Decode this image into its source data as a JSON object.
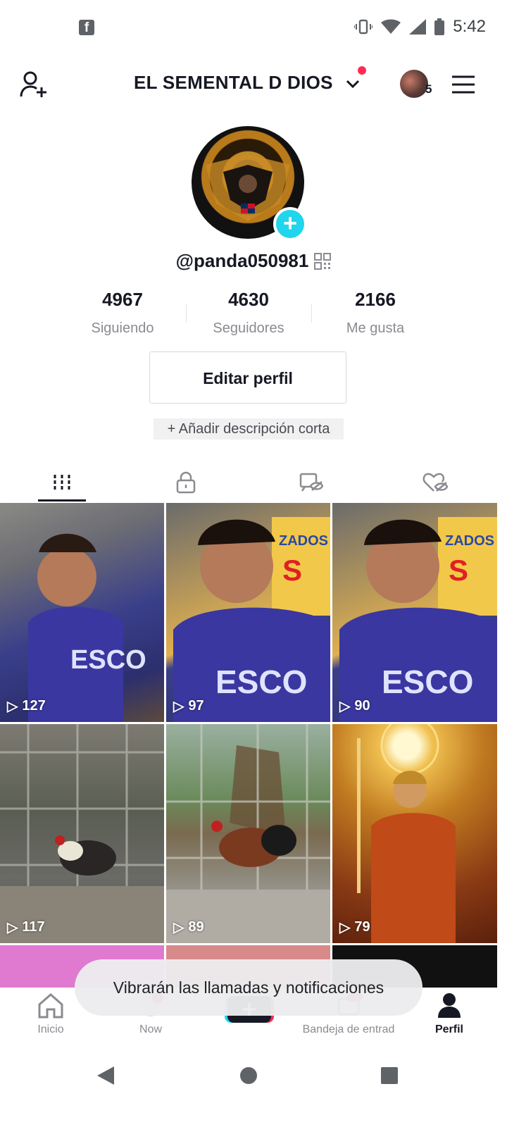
{
  "status_bar": {
    "time": "5:42",
    "notification_icon": "facebook-icon"
  },
  "header": {
    "username": "EL SEMENTAL D DIOS",
    "notification_count": "5"
  },
  "profile": {
    "handle": "@panda050981",
    "stats": [
      {
        "value": "4967",
        "label": "Siguiendo"
      },
      {
        "value": "4630",
        "label": "Seguidores"
      },
      {
        "value": "2166",
        "label": "Me gusta"
      }
    ],
    "edit_button": "Editar perfil",
    "add_description": "+ Añadir descripción corta"
  },
  "tabs": [
    "videos-grid-icon",
    "lock-icon",
    "bookmark-icon",
    "liked-icon"
  ],
  "videos": [
    {
      "views": "127"
    },
    {
      "views": "97"
    },
    {
      "views": "90"
    },
    {
      "views": "117"
    },
    {
      "views": "89"
    },
    {
      "views": "79"
    }
  ],
  "toast": "Vibrarán las llamadas y notificaciones",
  "bottom_nav": [
    {
      "label": "Inicio"
    },
    {
      "label": "Now"
    },
    {
      "label": ""
    },
    {
      "label": "Bandeja de entrad"
    },
    {
      "label": "Perfil"
    }
  ],
  "colors": {
    "accent": "#fe2c55",
    "cyan": "#20d5ec",
    "text": "#161823",
    "muted": "#8a8b91"
  }
}
